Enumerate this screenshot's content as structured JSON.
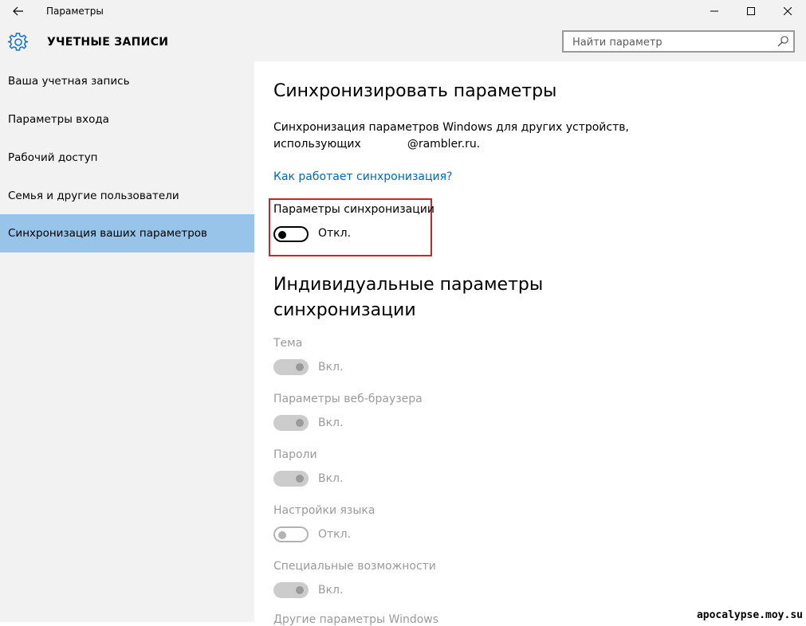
{
  "window": {
    "title": "Параметры",
    "controls": [
      "minimize",
      "maximize",
      "close"
    ]
  },
  "header": {
    "title": "УЧЕТНЫЕ ЗАПИСИ",
    "search_placeholder": "Найти параметр"
  },
  "sidebar": {
    "items": [
      {
        "label": "Ваша учетная запись"
      },
      {
        "label": "Параметры входа"
      },
      {
        "label": "Рабочий доступ"
      },
      {
        "label": "Семья и другие пользователи"
      },
      {
        "label": "Синхронизация ваших параметров",
        "active": true
      }
    ]
  },
  "main": {
    "title": "Синхронизировать параметры",
    "description_line1": "Синхронизация параметров Windows для других устройств,",
    "description_line2_prefix": "использующих",
    "description_line2_email": "@rambler.ru.",
    "help_link": "Как работает синхронизация?",
    "sync_settings": {
      "label": "Параметры синхронизации",
      "state": "Откл."
    },
    "individual_title": "Индивидуальные параметры синхронизации",
    "individual_items": [
      {
        "label": "Тема",
        "state": "Вкл."
      },
      {
        "label": "Параметры веб-браузера",
        "state": "Вкл."
      },
      {
        "label": "Пароли",
        "state": "Вкл."
      },
      {
        "label": "Настройки языка",
        "state": "Откл."
      },
      {
        "label": "Специальные возможности",
        "state": "Вкл."
      }
    ],
    "partial_item_label": "Другие параметры Windows"
  },
  "watermark": "apocalypse.moy.su",
  "colors": {
    "chrome_bg": "#f2f2f2",
    "active_nav": "#99c4e9",
    "link": "#0067b8",
    "highlight_border": "#c0282d",
    "disabled_text": "#9a9a9a"
  }
}
